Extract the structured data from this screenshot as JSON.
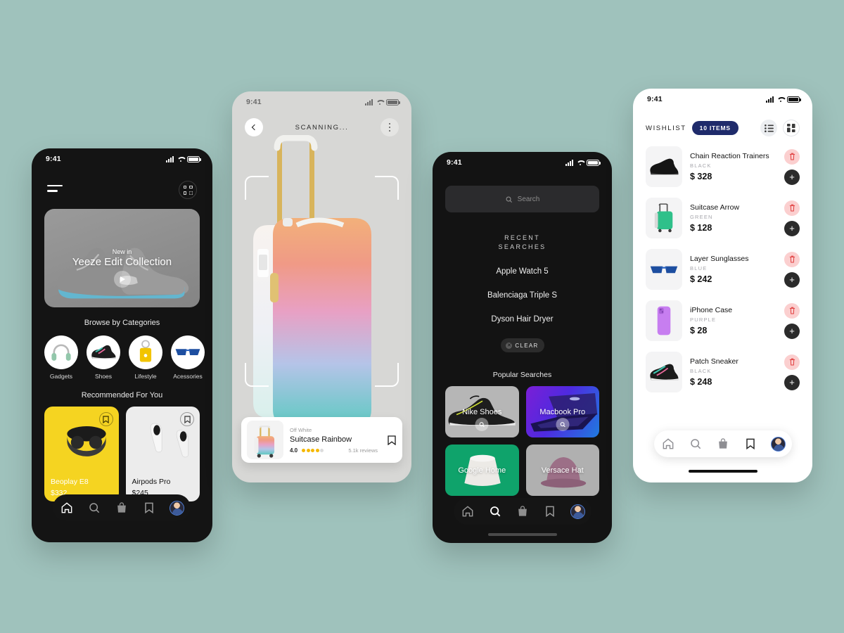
{
  "background_color": "#9fc2bc",
  "status_bar": {
    "time": "9:41"
  },
  "phone_home": {
    "hero": {
      "eyebrow": "New in",
      "title": "Yeeze Edit Collection"
    },
    "categories_title": "Browse by Categories",
    "categories": [
      {
        "label": "Gadgets",
        "icon": "headphones-icon"
      },
      {
        "label": "Shoes",
        "icon": "sneaker-icon"
      },
      {
        "label": "Lifestyle",
        "icon": "keychain-icon"
      },
      {
        "label": "Acessories",
        "icon": "sunglasses-icon"
      }
    ],
    "recommended_title": "Recommended For You",
    "recommended": [
      {
        "name": "Beoplay E8",
        "price": "$332",
        "bg": "#f5d421"
      },
      {
        "name": "Airpods Pro",
        "price": "$245",
        "bg": "#ececec"
      }
    ],
    "nav": [
      "home-icon",
      "search-icon",
      "bag-icon",
      "bookmark-icon",
      "avatar-icon"
    ]
  },
  "phone_scan": {
    "title": "SCANNING...",
    "product": {
      "brand": "Off White",
      "title": "Suitcase Rainbow",
      "rating": "4.0",
      "stars_filled": 4,
      "stars_total": 5,
      "reviews": "5.1k reviews"
    }
  },
  "phone_search": {
    "search_placeholder": "Search",
    "recent_title_line1": "RECENT",
    "recent_title_line2": "SEARCHES",
    "recent": [
      "Apple Watch 5",
      "Balenciaga Triple S",
      "Dyson Hair Dryer"
    ],
    "clear_label": "CLEAR",
    "popular_title": "Popular Searches",
    "popular": [
      {
        "label": "Nike Shoes",
        "bg": "#b6b6b6"
      },
      {
        "label": "Macbook Pro",
        "bg": "#6a22c8"
      },
      {
        "label": "Google Home",
        "bg": "#0fa36b"
      },
      {
        "label": "Versace Hat",
        "bg": "#b0b0b0"
      }
    ],
    "nav": [
      "home-icon",
      "search-icon",
      "bag-icon",
      "bookmark-icon",
      "avatar-icon"
    ]
  },
  "phone_wishlist": {
    "title": "WISHLIST",
    "count_badge": "10 ITEMS",
    "badge_color": "#1f2b6b",
    "view_list": "list-view-icon",
    "view_grid": "grid-view-icon",
    "items": [
      {
        "name": "Chain Reaction Trainers",
        "color": "BLACK",
        "price": "$ 328",
        "thumb": "sneaker"
      },
      {
        "name": "Suitcase Arrow",
        "color": "GREEN",
        "price": "$ 128",
        "thumb": "suitcase"
      },
      {
        "name": "Layer Sunglasses",
        "color": "BLUE",
        "price": "$ 242",
        "thumb": "sunglasses"
      },
      {
        "name": "iPhone Case",
        "color": "PURPLE",
        "price": "$ 28",
        "thumb": "phonecase"
      },
      {
        "name": "Patch Sneaker",
        "color": "BLACK",
        "price": "$ 248",
        "thumb": "sneaker2"
      }
    ],
    "nav": [
      "home-icon",
      "search-icon",
      "bag-icon",
      "bookmark-icon",
      "avatar-icon"
    ]
  }
}
